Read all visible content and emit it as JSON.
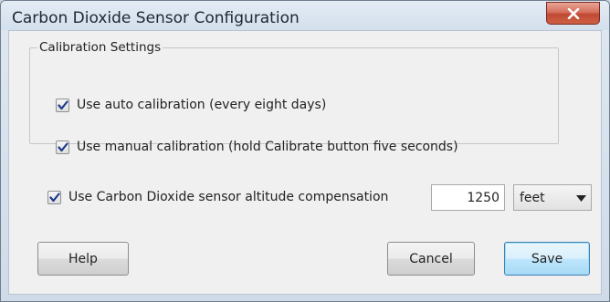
{
  "window": {
    "title": "Carbon Dioxide Sensor Configuration",
    "close_icon": "close-icon"
  },
  "calibration": {
    "group_label": "Calibration Settings",
    "auto": {
      "label": "Use auto calibration (every eight days)",
      "checked": true
    },
    "manual": {
      "label": "Use manual calibration (hold Calibrate button five seconds)",
      "checked": true
    }
  },
  "altitude": {
    "label": "Use Carbon Dioxide sensor altitude compensation",
    "checked": true,
    "value": "1250",
    "unit": "feet",
    "unit_icon": "dropdown-arrow-icon"
  },
  "buttons": {
    "help": "Help",
    "cancel": "Cancel",
    "save": "Save"
  },
  "colors": {
    "close_button": "#c94f3a",
    "checkmark": "#1f3a8a",
    "primary_button_border": "#3c7fb1"
  }
}
